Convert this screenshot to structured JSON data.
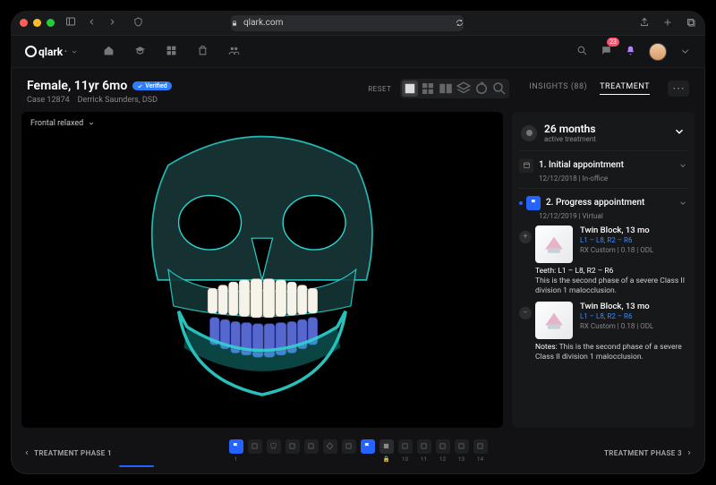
{
  "browser": {
    "url": "qlark.com"
  },
  "brand": "qlark",
  "nav_notif_count": "23",
  "patient": {
    "title": "Female, 11yr 6mo",
    "verified_label": "Verified",
    "case_id": "Case 12874",
    "doctor": "Derrick Saunders, DSD"
  },
  "toolbar": {
    "reset": "RESET",
    "insights_label": "INSIGHTS (88)",
    "treatment_label": "TREATMENT"
  },
  "viewer": {
    "view_label": "Frontal relaxed"
  },
  "treatment_panel": {
    "duration": "26 months",
    "duration_sub": "active treatment",
    "appt1": {
      "title": "1. Initial appointment",
      "sub": "12/12/2018  |  In-office"
    },
    "appt2": {
      "title": "2. Progress appointment",
      "sub": "12/12/2019  |  Virtual",
      "card1": {
        "title": "Twin Block, 13 mo",
        "range": "L1 – L8, R2 – R6",
        "meta": "RX Custom  |  0.18  |  ODL",
        "teeth": "Teeth: L1 – L8, R2 – R6",
        "desc": "This is the second phase of a severe Class II division 1 malocclusion."
      },
      "card2": {
        "title": "Twin Block, 13 mo",
        "range": "L1 – L8, R2 – R6",
        "meta": "RX Custom  |  0.18  |  ODL",
        "notes_label": "Notes:",
        "notes": " This is the second phase of a severe Class II division 1 malocclusion."
      }
    }
  },
  "timeline": {
    "prev": "TREATMENT PHASE 1",
    "next": "TREATMENT PHASE 3",
    "nums": [
      "1",
      "",
      "",
      "",
      "",
      "",
      "",
      "",
      "",
      "10",
      "11",
      "12",
      "13",
      "14"
    ]
  }
}
